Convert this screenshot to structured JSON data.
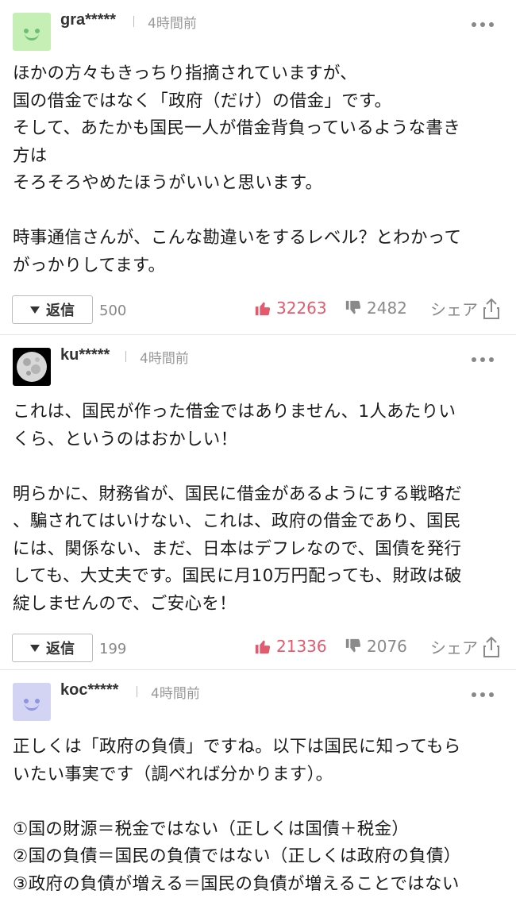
{
  "comments": [
    {
      "user": "gra*****",
      "time": "4時間前",
      "avatar": "smiley-green",
      "text": "ほかの方々もきっちり指摘されていますが、\n国の借金ではなく「政府（だけ）の借金」です。\nそして、あたかも国民一人が借金背負っているような書き\n方は\nそろそろやめたほうがいいと思います。\n\n時事通信さんが、こんな勘違いをするレベル？とわかって\nがっかりしてます。",
      "reply_label": "返信",
      "reply_count": "500",
      "likes": "32263",
      "dislikes": "2482",
      "share_label": "シェア"
    },
    {
      "user": "ku*****",
      "time": "4時間前",
      "avatar": "moon-photo",
      "text": "これは、国民が作った借金ではありません、1人あたりい\nくら、というのはおかしい！\n\n明らかに、財務省が、国民に借金があるようにする戦略だ\n、騙されてはいけない、これは、政府の借金であり、国民\nには、関係ない、まだ、日本はデフレなので、国債を発行\nしても、大丈夫です。国民に月10万円配っても、財政は破\n綻しませんので、ご安心を！",
      "reply_label": "返信",
      "reply_count": "199",
      "likes": "21336",
      "dislikes": "2076",
      "share_label": "シェア"
    },
    {
      "user": "koc*****",
      "time": "4時間前",
      "avatar": "smiley-lavender",
      "text": "正しくは「政府の負債」ですね。以下は国民に知ってもら\nいたい事実です（調べれば分かります）。\n\n①国の財源＝税金ではない（正しくは国債＋税金）\n②国の負債＝国民の負債ではない（正しくは政府の負債）\n③政府の負債が増える＝国民の負債が増えることではない"
    }
  ],
  "colors": {
    "like": "#e3596d",
    "muted": "#8a8a8a"
  }
}
